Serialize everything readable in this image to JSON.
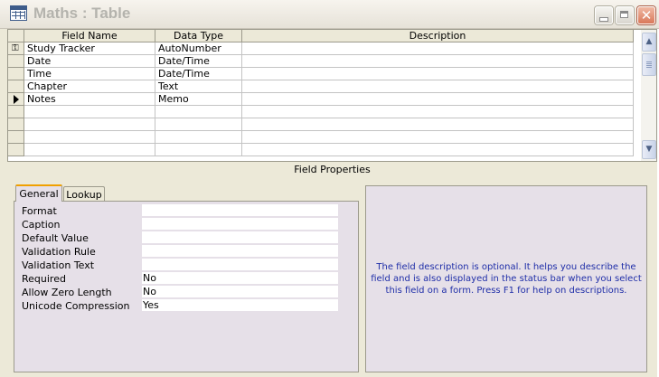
{
  "window": {
    "title": "Maths : Table",
    "close_glyph": "✕"
  },
  "grid": {
    "headers": [
      "Field Name",
      "Data Type",
      "Description"
    ],
    "rows": [
      {
        "name": "Study Tracker",
        "type": "AutoNumber",
        "desc": "",
        "marker": "key-icon"
      },
      {
        "name": "Date",
        "type": "Date/Time",
        "desc": ""
      },
      {
        "name": "Time",
        "type": "Date/Time",
        "desc": ""
      },
      {
        "name": "Chapter",
        "type": "Text",
        "desc": ""
      },
      {
        "name": "Notes",
        "type": "Memo",
        "desc": "",
        "marker": "current-row-arrow"
      },
      {
        "name": "",
        "type": "",
        "desc": ""
      },
      {
        "name": "",
        "type": "",
        "desc": ""
      },
      {
        "name": "",
        "type": "",
        "desc": ""
      },
      {
        "name": "",
        "type": "",
        "desc": ""
      }
    ],
    "key_glyph": "⚿",
    "scroll_up_glyph": "▲",
    "scroll_down_glyph": "▼"
  },
  "field_properties": {
    "caption": "Field Properties",
    "tabs": [
      {
        "label": "General",
        "active": true
      },
      {
        "label": "Lookup",
        "active": false
      }
    ],
    "properties": [
      {
        "label": "Format",
        "value": ""
      },
      {
        "label": "Caption",
        "value": ""
      },
      {
        "label": "Default Value",
        "value": ""
      },
      {
        "label": "Validation Rule",
        "value": ""
      },
      {
        "label": "Validation Text",
        "value": ""
      },
      {
        "label": "Required",
        "value": "No"
      },
      {
        "label": "Allow Zero Length",
        "value": "No"
      },
      {
        "label": "Unicode Compression",
        "value": "Yes"
      }
    ],
    "help_text": "The field description is optional.  It helps you describe the field and is also displayed in the status bar when you select this field on a form.  Press F1 for help on descriptions."
  },
  "colors": {
    "help_text": "#1f2ea8",
    "pane_background": "#e6e0e8",
    "window_background": "#ece9d8"
  }
}
